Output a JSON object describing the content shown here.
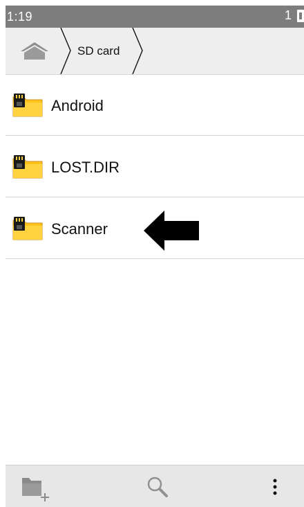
{
  "status_bar": {
    "time": "1:19",
    "sim_indicator": "1"
  },
  "breadcrumb": {
    "home_icon": "home-icon",
    "current": "SD card"
  },
  "files": [
    {
      "name": "Android",
      "icon": "sd-folder-icon"
    },
    {
      "name": "LOST.DIR",
      "icon": "sd-folder-icon"
    },
    {
      "name": "Scanner",
      "icon": "sd-folder-icon"
    }
  ],
  "bottom_bar": {
    "new_folder_icon": "new-folder-icon",
    "search_icon": "search-icon",
    "menu_icon": "more-vert-icon"
  },
  "colors": {
    "status_bar": "#7d7d7d",
    "breadcrumb_bg": "#eeeeee",
    "folder_yellow": "#ffc21a",
    "bottom_bar_bg": "#e7e7e7"
  }
}
